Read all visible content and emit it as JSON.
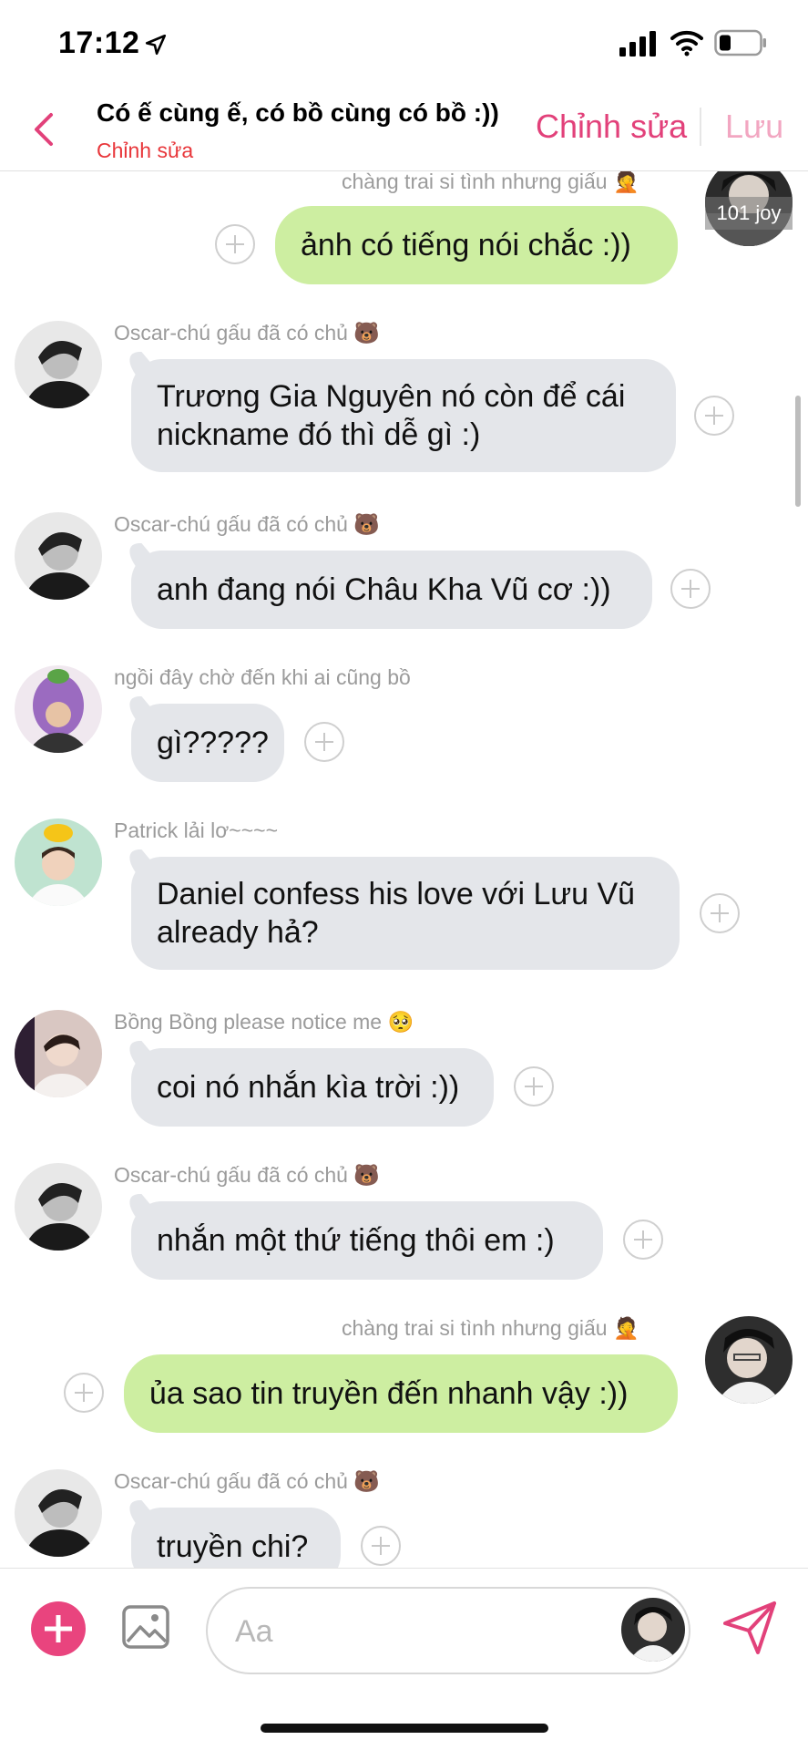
{
  "status": {
    "time": "17:12"
  },
  "header": {
    "title": "Có ế cùng ế, có bồ cùng có bồ :))",
    "subtitle": "Chỉnh sửa",
    "edit_label": "Chỉnh sửa",
    "save_label": "Lưu"
  },
  "messages": [
    {
      "sender": "chàng trai si tình nhưng giấu 🤦",
      "text": "ảnh có tiếng nói chắc :))",
      "avatar_overlay": "101 joy",
      "direction": "out"
    },
    {
      "sender": "Oscar-chú gấu đã có chủ 🐻",
      "text_line1": "Trương Gia Nguyên nó còn để cái",
      "text_line2": "nickname đó thì dễ gì :)",
      "direction": "in"
    },
    {
      "sender": "Oscar-chú gấu đã có chủ 🐻",
      "text": "anh đang nói Châu Kha Vũ cơ :))",
      "direction": "in"
    },
    {
      "sender": "ngồi đây chờ đến khi ai cũng bồ",
      "text": "gì?????",
      "direction": "in"
    },
    {
      "sender": "Patrick lải lơ~~~~",
      "text_line1": "Daniel confess his love với Lưu Vũ",
      "text_line2": "already hả?",
      "direction": "in"
    },
    {
      "sender": "Bồng Bồng please notice me 🥺",
      "text": "coi nó nhắn kìa trời :))",
      "direction": "in"
    },
    {
      "sender": "Oscar-chú gấu đã có chủ 🐻",
      "text": "nhắn một thứ tiếng thôi em :)",
      "direction": "in"
    },
    {
      "sender": "chàng trai si tình nhưng giấu 🤦",
      "text": "ủa sao tin truyền đến nhanh vậy :))",
      "direction": "out"
    },
    {
      "sender": "Oscar-chú gấu đã có chủ 🐻",
      "text": "truyền chi?",
      "direction": "in"
    }
  ],
  "composer": {
    "placeholder": "Aa"
  },
  "colors": {
    "accent": "#e2417a",
    "outgoing": "#cdeea1",
    "incoming": "#e4e6ea"
  }
}
